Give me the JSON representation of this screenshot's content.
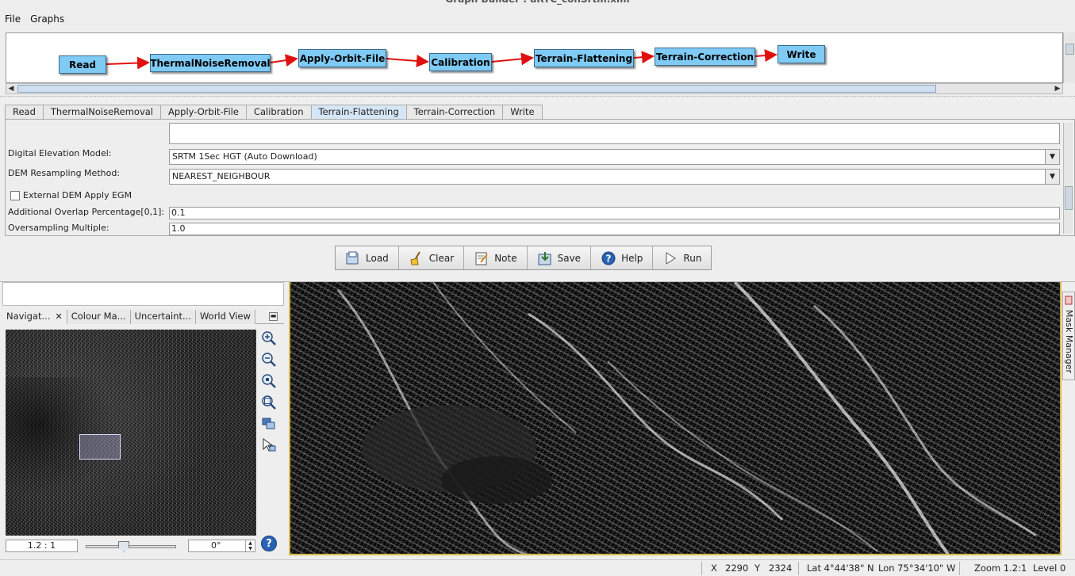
{
  "window": {
    "title": "Graph Builder : aRTC_conSrtm.xml"
  },
  "menu": {
    "items": [
      "File",
      "Graphs"
    ]
  },
  "graph": {
    "nodes": [
      "Read",
      "ThermalNoiseRemoval",
      "Apply-Orbit-File",
      "Calibration",
      "Terrain-Flattening",
      "Terrain-Correction",
      "Write"
    ],
    "edge_color": "#e01010",
    "node_color": "#7fcbf6"
  },
  "tabs": {
    "items": [
      "Read",
      "ThermalNoiseRemoval",
      "Apply-Orbit-File",
      "Calibration",
      "Terrain-Flattening",
      "Terrain-Correction",
      "Write"
    ],
    "active": "Terrain-Flattening"
  },
  "params": {
    "dem_label": "Digital Elevation Model:",
    "dem_value": "SRTM 1Sec HGT (Auto Download)",
    "resampling_label": "DEM Resampling Method:",
    "resampling_value": "NEAREST_NEIGHBOUR",
    "external_dem_label": "External DEM Apply EGM",
    "overlap_label": "Additional Overlap Percentage[0,1]:",
    "overlap_value": "0.1",
    "oversampling_label": "Oversampling Multiple:",
    "oversampling_value": "1.0"
  },
  "buttons": {
    "load": "Load",
    "clear": "Clear",
    "note": "Note",
    "save": "Save",
    "help": "Help",
    "run": "Run"
  },
  "navigation": {
    "tabs": [
      "Navigat...",
      "Colour Ma...",
      "Uncertaint...",
      "World View"
    ],
    "zoom_ratio": "1.2 : 1",
    "rotation": "0°",
    "tools": [
      "zoom-in-icon",
      "zoom-out-icon",
      "zoom-pixel-icon",
      "zoom-all-icon",
      "sync-views-icon",
      "sync-cursor-icon"
    ]
  },
  "side_panel": {
    "label": "Mask Manager"
  },
  "status": {
    "x_label": "X",
    "x_value": "2290",
    "y_label": "Y",
    "y_value": "2324",
    "lat": "Lat 4°44'38\" N",
    "lon": "Lon 75°34'10\" W",
    "zoom": "Zoom 1.2:1",
    "level": "Level 0"
  }
}
